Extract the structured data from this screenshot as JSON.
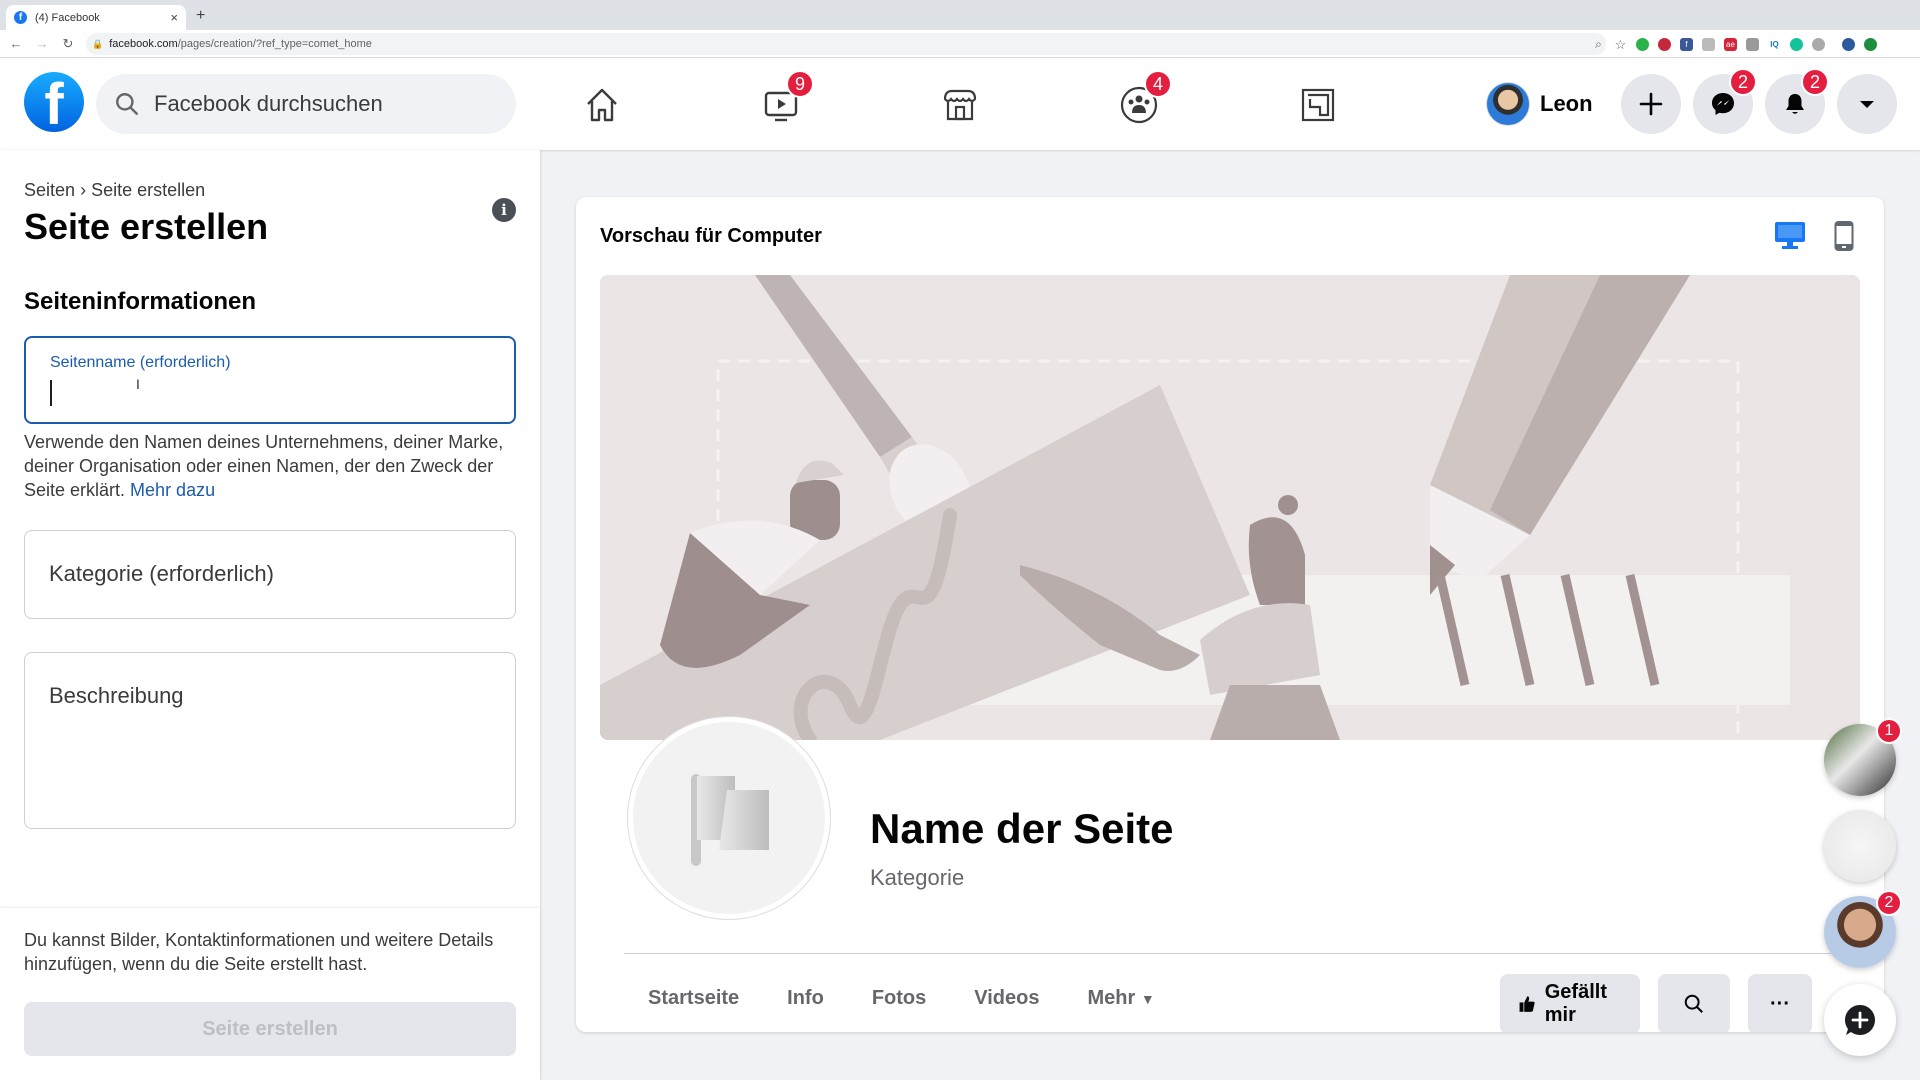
{
  "browser": {
    "tab_title": "(4) Facebook",
    "new_tab": "+",
    "close": "×",
    "url_domain": "facebook.com",
    "url_path": "/pages/creation/?ref_type=comet_home"
  },
  "topbar": {
    "search_placeholder": "Facebook durchsuchen",
    "nav": [
      {
        "name": "home",
        "badge": null
      },
      {
        "name": "watch",
        "badge": "9"
      },
      {
        "name": "marketplace",
        "badge": null
      },
      {
        "name": "groups",
        "badge": "4"
      },
      {
        "name": "gaming",
        "badge": null
      }
    ],
    "profile_name": "Leon",
    "messenger_badge": "2",
    "notifications_badge": "2"
  },
  "left": {
    "breadcrumb_root": "Seiten",
    "breadcrumb_sep": "›",
    "breadcrumb_current": "Seite erstellen",
    "title": "Seite erstellen",
    "section": "Seiteninformationen",
    "page_name_label": "Seitenname (erforderlich)",
    "page_name_value": "",
    "help_text": "Verwende den Namen deines Unternehmens, deiner Marke, deiner Organisation oder einen Namen, der den Zweck der Seite erklärt. ",
    "help_link": "Mehr dazu",
    "category_label": "Kategorie (erforderlich)",
    "description_label": "Beschreibung",
    "footer_note": "Du kannst Bilder, Kontaktinformationen und weitere Details hinzufügen, wenn du die Seite erstellt hast.",
    "create_button": "Seite erstellen"
  },
  "preview": {
    "title": "Vorschau für Computer",
    "active_device": "desktop",
    "page_name": "Name der Seite",
    "category": "Kategorie",
    "tabs": [
      "Startseite",
      "Info",
      "Fotos",
      "Videos",
      "Mehr"
    ],
    "like_button": "Gefällt mir",
    "more_button": "···"
  },
  "chats": [
    {
      "badge": "1"
    },
    {
      "badge": null
    },
    {
      "badge": "2"
    }
  ],
  "colors": {
    "accent": "#1877f2",
    "badge": "#e41e3f",
    "link": "#1b5cad"
  }
}
